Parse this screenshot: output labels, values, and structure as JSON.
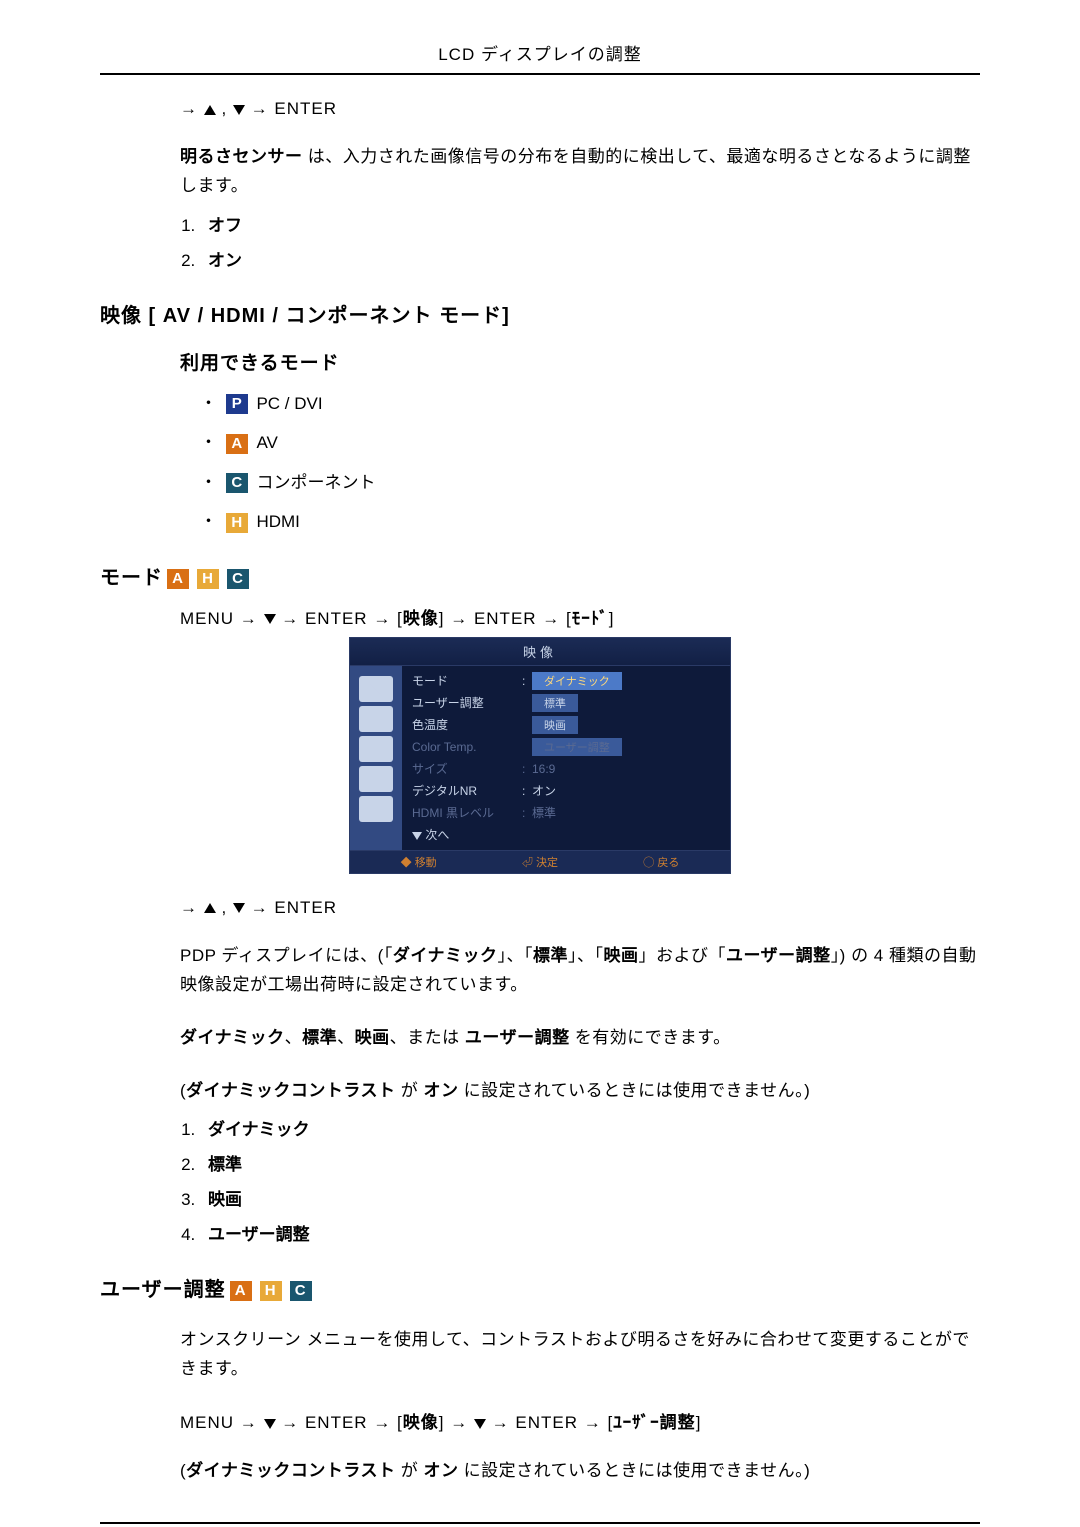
{
  "header": {
    "title": "LCD ディスプレイの調整"
  },
  "nav1": {
    "enter": "ENTER"
  },
  "brightness": {
    "label": "明るさセンサー",
    "desc": " は、入力された画像信号の分布を自動的に検出して、最適な明るさとなるように調整します。",
    "items": [
      "オフ",
      "オン"
    ]
  },
  "videoHeading": "映像 [ AV / HDMI / コンポーネント モード]",
  "availableHeading": "利用できるモード",
  "modes": {
    "p_label": "PC / DVI",
    "a_label": "AV",
    "c_label": "コンポーネント",
    "h_label": "HDMI"
  },
  "modeHeading": "モード",
  "modeNav": {
    "menu": "MENU",
    "enter": "ENTER",
    "target1": "映像",
    "target2": "ﾓｰﾄﾞ"
  },
  "osd": {
    "title": "映像",
    "rows": {
      "mode": {
        "label": "モード",
        "val": "ダイナミック",
        "selected": true
      },
      "user": {
        "label": "ユーザー調整",
        "val": "標準"
      },
      "coltemp": {
        "label": "色温度",
        "val": "映画"
      },
      "colortone": {
        "label": "Color Temp.",
        "val": "ユーザー調整"
      },
      "size": {
        "label": "サイズ",
        "val": "16:9"
      },
      "dnr": {
        "label": "デジタルNR",
        "val": "オン"
      },
      "hdmibl": {
        "label": "HDMI 黒レベル",
        "val": "標準"
      },
      "next": {
        "label": "次へ"
      }
    },
    "footer": {
      "move": "移動",
      "enter": "決定",
      "return": "戻る"
    }
  },
  "nav2": {
    "enter": "ENTER"
  },
  "pdp": {
    "pre": "PDP ディスプレイには、(「",
    "dyn": "ダイナミック",
    "mid1": "」、「",
    "std": "標準",
    "mid2": "」、「",
    "mov": "映画",
    "mid3": "」および「",
    "usr": "ユーザー調整",
    "post": "」) の 4 種類の自動映像設定が工場出荷時に設定されています。"
  },
  "enableLine": {
    "dyn": "ダイナミック",
    "std": "標準",
    "mov": "映画",
    "or": "、または ",
    "usr": "ユーザー調整",
    "post": " を有効にできます。"
  },
  "dcNote": {
    "open": "(",
    "dc": "ダイナミックコントラスト",
    "mid": " が ",
    "on": "オン",
    "post": " に設定されているときには使用できません。)"
  },
  "modeList": [
    "ダイナミック",
    "標準",
    "映画",
    "ユーザー調整"
  ],
  "userHeading": "ユーザー調整",
  "userDesc": "オンスクリーン メニューを使用して、コントラストおよび明るさを好みに合わせて変更することができます。",
  "userNav": {
    "menu": "MENU",
    "enter": "ENTER",
    "target1": "映像",
    "target2": "ﾕｰｻﾞｰ調整"
  }
}
